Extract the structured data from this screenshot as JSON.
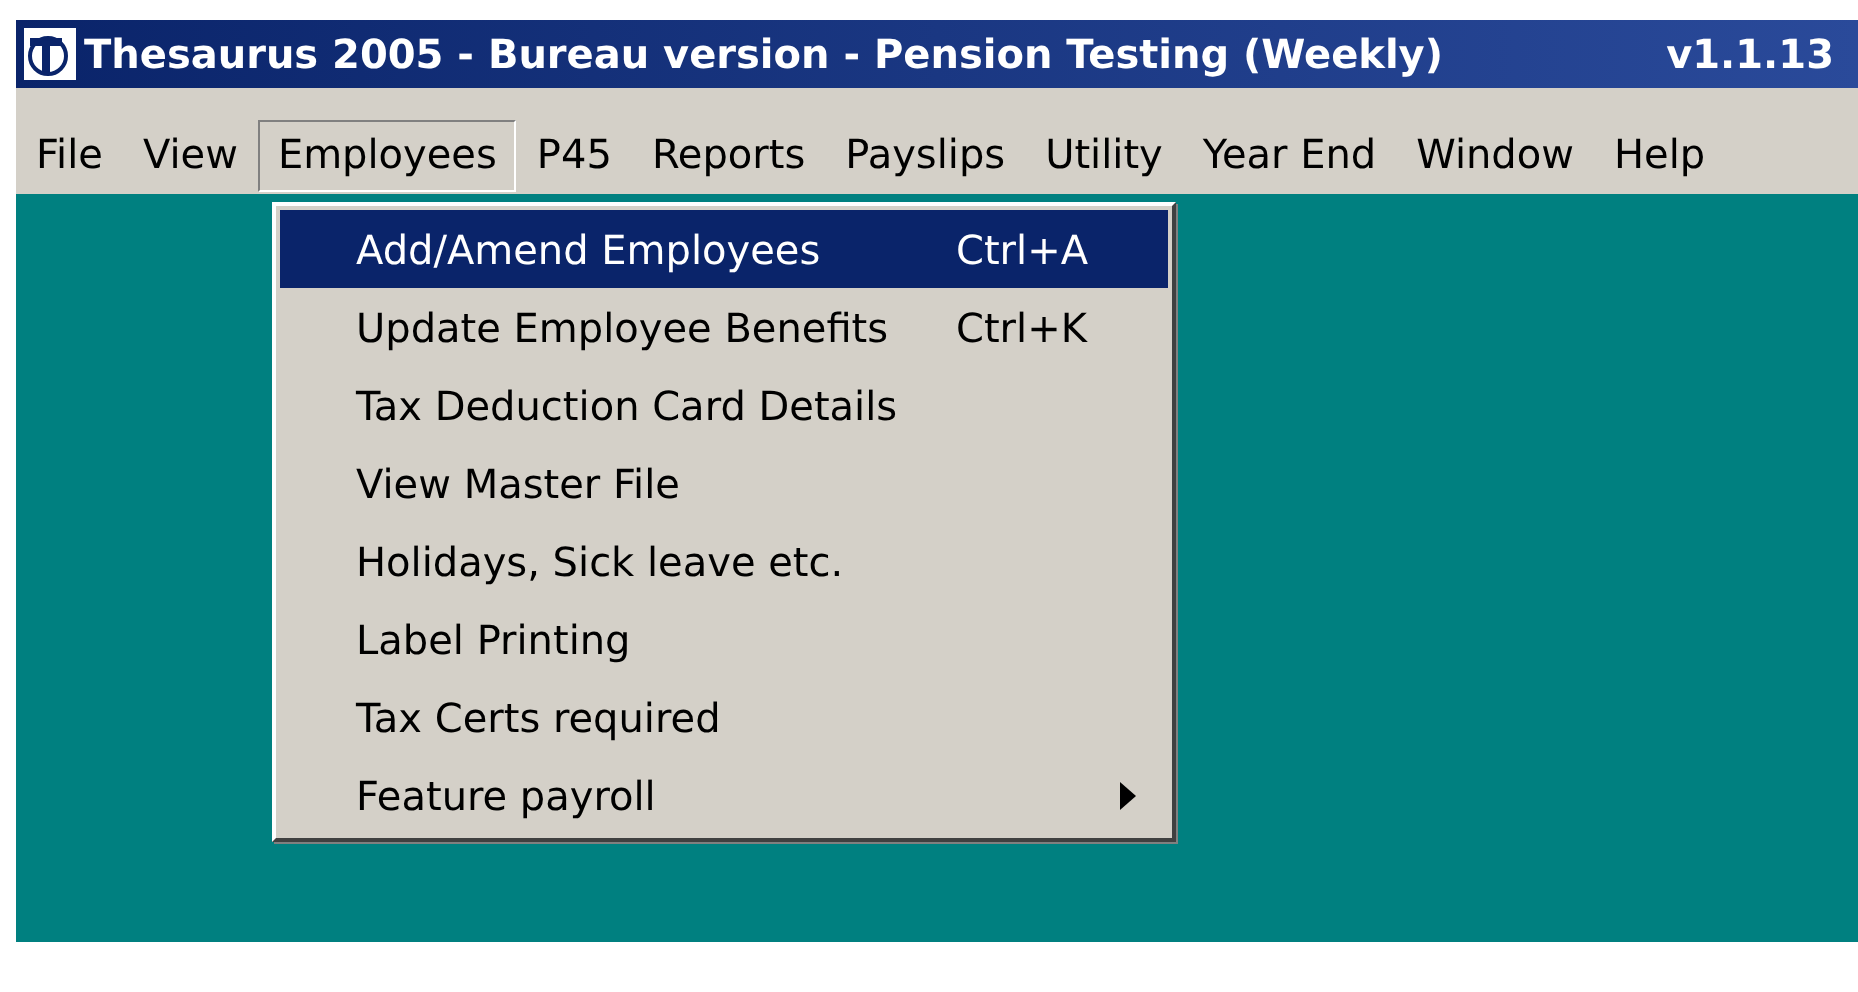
{
  "window": {
    "title": "Thesaurus 2005 - Bureau version - Pension Testing (Weekly)",
    "version": "v1.1.13"
  },
  "menu_bar": [
    {
      "label": "File",
      "selected": false
    },
    {
      "label": "View",
      "selected": false
    },
    {
      "label": "Employees",
      "selected": true
    },
    {
      "label": "P45",
      "selected": false
    },
    {
      "label": "Reports",
      "selected": false
    },
    {
      "label": "Payslips",
      "selected": false
    },
    {
      "label": "Utility",
      "selected": false
    },
    {
      "label": "Year End",
      "selected": false
    },
    {
      "label": "Window",
      "selected": false
    },
    {
      "label": "Help",
      "selected": false
    }
  ],
  "dropdown": [
    {
      "label": "Add/Amend Employees",
      "shortcut": "Ctrl+A",
      "selected": true,
      "kind": "command"
    },
    {
      "label": "Update Employee Benefits",
      "shortcut": "Ctrl+K",
      "selected": false,
      "kind": "command"
    },
    {
      "label": "Tax Deduction Card Details",
      "selected": false,
      "kind": "command"
    },
    {
      "label": "View Master File",
      "selected": false,
      "kind": "command"
    },
    {
      "label": "Holidays, Sick leave etc.",
      "selected": false,
      "kind": "command"
    },
    {
      "label": "Label Printing",
      "selected": false,
      "kind": "command"
    },
    {
      "label": "Tax Certs required",
      "selected": false,
      "kind": "command"
    },
    {
      "label": "Feature payroll",
      "selected": false,
      "kind": "submenu"
    }
  ]
}
